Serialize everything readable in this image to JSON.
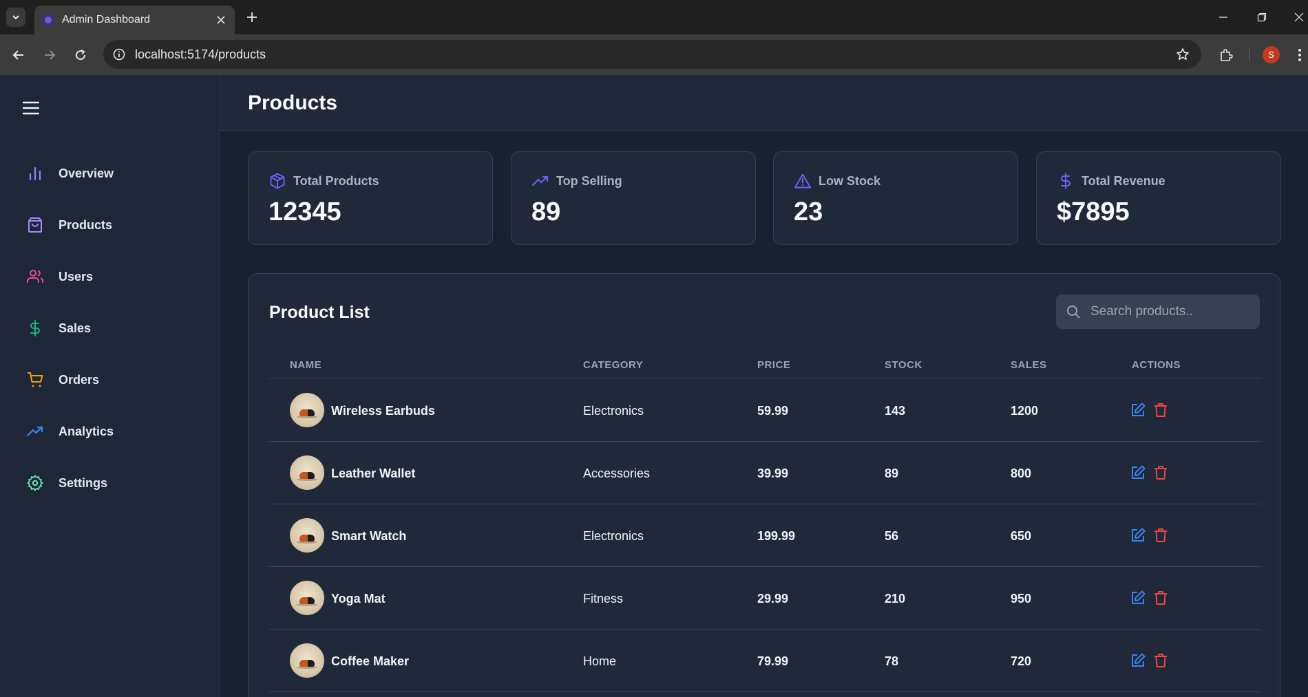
{
  "browser": {
    "tab_title": "Admin Dashboard",
    "url": "localhost:5174/products",
    "profile_initial": "S"
  },
  "sidebar": {
    "items": [
      {
        "label": "Overview",
        "icon": "bar-chart-icon",
        "color": "#818cf8"
      },
      {
        "label": "Products",
        "icon": "shopping-bag-icon",
        "color": "#a78bfa"
      },
      {
        "label": "Users",
        "icon": "users-icon",
        "color": "#ec4899"
      },
      {
        "label": "Sales",
        "icon": "dollar-sign-icon",
        "color": "#10b981"
      },
      {
        "label": "Orders",
        "icon": "shopping-cart-icon",
        "color": "#f59e0b"
      },
      {
        "label": "Analytics",
        "icon": "trending-up-icon",
        "color": "#3b82f6"
      },
      {
        "label": "Settings",
        "icon": "gear-icon",
        "color": "#6ee7b7"
      }
    ]
  },
  "header": {
    "title": "Products"
  },
  "stats": [
    {
      "label": "Total Products",
      "value": "12345",
      "icon": "package-icon",
      "color": "#6366f1"
    },
    {
      "label": "Top Selling",
      "value": "89",
      "icon": "trending-up-icon",
      "color": "#6366f1"
    },
    {
      "label": "Low Stock",
      "value": "23",
      "icon": "alert-triangle-icon",
      "color": "#6366f1"
    },
    {
      "label": "Total Revenue",
      "value": "$7895",
      "icon": "dollar-sign-icon",
      "color": "#6366f1"
    }
  ],
  "product_list": {
    "title": "Product List",
    "search_placeholder": "Search products..",
    "columns": [
      "NAME",
      "CATEGORY",
      "PRICE",
      "STOCK",
      "SALES",
      "ACTIONS"
    ],
    "rows": [
      {
        "name": "Wireless Earbuds",
        "category": "Electronics",
        "price": "59.99",
        "stock": "143",
        "sales": "1200"
      },
      {
        "name": "Leather Wallet",
        "category": "Accessories",
        "price": "39.99",
        "stock": "89",
        "sales": "800"
      },
      {
        "name": "Smart Watch",
        "category": "Electronics",
        "price": "199.99",
        "stock": "56",
        "sales": "650"
      },
      {
        "name": "Yoga Mat",
        "category": "Fitness",
        "price": "29.99",
        "stock": "210",
        "sales": "950"
      },
      {
        "name": "Coffee Maker",
        "category": "Home",
        "price": "79.99",
        "stock": "78",
        "sales": "720"
      }
    ]
  },
  "colors": {
    "edit": "#3b82f6",
    "delete": "#ef4444",
    "accent": "#6366f1"
  }
}
